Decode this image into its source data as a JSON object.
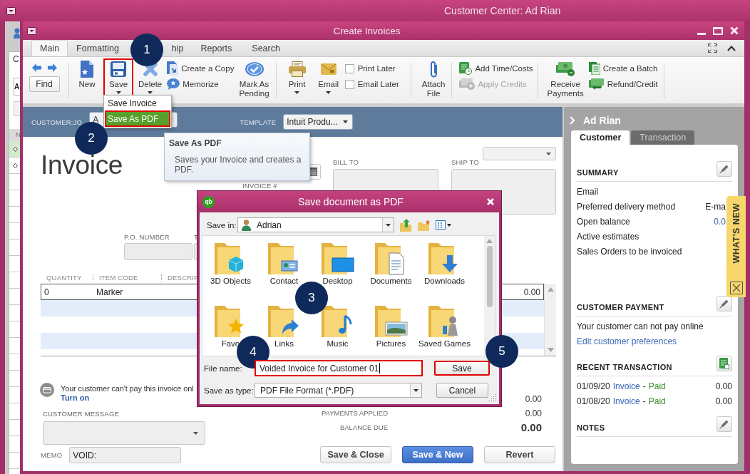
{
  "background_window": {
    "title": "Customer Center: Ad Rian",
    "tab": "C",
    "field": "A",
    "column_header": "N",
    "rows": [
      {
        "selected": true
      },
      {
        "selected": false
      }
    ]
  },
  "window": {
    "title": "Create Invoices"
  },
  "tabs": [
    {
      "label": "Main",
      "selected": true
    },
    {
      "label": "Formatting",
      "selected": false
    },
    {
      "label": "hip",
      "selected": false
    },
    {
      "label": "Reports",
      "selected": false
    },
    {
      "label": "Search",
      "selected": false
    }
  ],
  "toolbar": {
    "groups": [
      {
        "items": [
          {
            "kind": "nav",
            "label": "Find"
          }
        ]
      },
      {
        "items": [
          {
            "kind": "large",
            "label": "New",
            "dropdown": false,
            "highlighted": false
          },
          {
            "kind": "large",
            "label": "Save",
            "dropdown": true,
            "highlighted": true
          },
          {
            "kind": "large",
            "label": "Delete",
            "dropdown": true,
            "highlighted": false
          },
          {
            "kind": "stack",
            "items": [
              {
                "label": "Create a Copy",
                "disabled": false
              },
              {
                "label": "Memorize",
                "disabled": false
              }
            ]
          },
          {
            "kind": "large",
            "label": "Mark As\nPending",
            "dropdown": false,
            "highlighted": false
          }
        ]
      },
      {
        "items": [
          {
            "kind": "large",
            "label": "Print",
            "dropdown": true,
            "highlighted": false
          },
          {
            "kind": "large",
            "label": "Email",
            "dropdown": true,
            "highlighted": false
          },
          {
            "kind": "checks",
            "items": [
              {
                "label": "Print Later",
                "checked": false
              },
              {
                "label": "Email Later",
                "checked": false
              }
            ]
          }
        ]
      },
      {
        "items": [
          {
            "kind": "large",
            "label": "Attach\nFile",
            "dropdown": false,
            "highlighted": false
          }
        ]
      },
      {
        "items": [
          {
            "kind": "stack",
            "items": [
              {
                "label": "Add Time/Costs",
                "disabled": false
              },
              {
                "label": "Apply Credits",
                "disabled": true
              }
            ]
          }
        ]
      },
      {
        "items": [
          {
            "kind": "large",
            "label": "Receive\nPayments",
            "dropdown": false,
            "highlighted": false
          },
          {
            "kind": "stack",
            "items": [
              {
                "label": "Create a Batch",
                "disabled": false
              },
              {
                "label": "Refund/Credit",
                "disabled": false
              }
            ]
          }
        ]
      }
    ]
  },
  "save_menu": {
    "items": [
      {
        "label": "Save Invoice",
        "selected": false,
        "highlighted": false
      },
      {
        "label": "Save As PDF",
        "selected": true,
        "highlighted": true
      }
    ]
  },
  "tooltip": {
    "title": "Save As PDF",
    "text": "Saves your Invoice and creates a PDF."
  },
  "invoice": {
    "customer_label": "CUSTOMER:JO",
    "customer_value": "A",
    "template_label": "TEMPLATE",
    "template_value": "Intuit Produ...",
    "title": "Invoice",
    "invoice_number_label": "INVOICE #",
    "bill_to_label": "BILL TO",
    "ship_to_label": "SHIP TO",
    "po_number_label": "P.O. NUMBER",
    "terms_label": "T",
    "table": {
      "columns": [
        "QUANTITY",
        "ITEM CODE",
        "DESCRIP"
      ],
      "rows": [
        {
          "quantity": "0",
          "item_code": "Marker",
          "right_column": "0.00",
          "selected": true
        }
      ]
    },
    "online_notice": "Your customer can't pay this invoice onl",
    "turn_on_link": "Turn on",
    "customer_message_label": "CUSTOMER MESSAGE",
    "memo_label": "MEMO",
    "memo": "VOID:",
    "totals": [
      {
        "value": "0.00",
        "emphasis": false
      },
      {
        "label": "PAYMENTS APPLIED",
        "value": "0.00",
        "emphasis": false
      },
      {
        "label": "BALANCE DUE",
        "value": "0.00",
        "emphasis": true
      }
    ],
    "buttons": [
      {
        "label": "Save & Close",
        "primary": false
      },
      {
        "label": "Save & New",
        "primary": true
      },
      {
        "label": "Revert",
        "primary": false
      }
    ]
  },
  "customer_panel": {
    "name": "Ad Rian",
    "tabs": [
      {
        "label": "Customer",
        "selected": true
      },
      {
        "label": "Transaction",
        "selected": false
      }
    ],
    "summary": {
      "title": "SUMMARY",
      "rows": [
        {
          "label": "Email"
        },
        {
          "label": "Preferred delivery method",
          "value": {
            "text": "E-ma",
            "link": false
          }
        },
        {
          "label": "Open balance",
          "value": {
            "text": "0.0",
            "link": true
          }
        },
        {
          "label": "Active estimates"
        },
        {
          "label": "Sales Orders to be invoiced"
        }
      ]
    },
    "payment": {
      "title": "CUSTOMER PAYMENT",
      "text": "Your customer can not pay online",
      "link": "Edit customer preferences"
    },
    "recent": {
      "title": "RECENT TRANSACTION",
      "rows": [
        {
          "date": "01/09/20",
          "type": "Invoice",
          "dash": "-",
          "status": "Paid",
          "amount": "0.00"
        },
        {
          "date": "01/08/20",
          "type": "Invoice",
          "dash": "-",
          "status": "Paid",
          "amount": "0.00"
        }
      ]
    },
    "notes": {
      "title": "NOTES"
    }
  },
  "whats_new": {
    "label": "WHAT'S NEW"
  },
  "dialog": {
    "logo": "qb",
    "title": "Save document as PDF",
    "save_in_label": "Save in:",
    "save_in_value": "Adrian",
    "folders": [
      {
        "label": "3D Objects"
      },
      {
        "label": "Contact"
      },
      {
        "label": "Desktop"
      },
      {
        "label": "Documents"
      },
      {
        "label": "Downloads"
      },
      {
        "label": "Favo"
      },
      {
        "label": "Links"
      },
      {
        "label": "Music"
      },
      {
        "label": "Pictures"
      },
      {
        "label": "Saved Games"
      }
    ],
    "file_name_label": "File name:",
    "file_name": {
      "value": "Voided Invoice for Customer 01",
      "highlighted": true,
      "focused": true
    },
    "save_as_type_label": "Save as type:",
    "save_as_type": "PDF File Format (*.PDF)",
    "buttons": [
      {
        "label": "Save",
        "highlighted": true
      },
      {
        "label": "Cancel",
        "highlighted": false
      }
    ]
  },
  "callouts": [
    "1",
    "2",
    "3",
    "4",
    "5"
  ]
}
